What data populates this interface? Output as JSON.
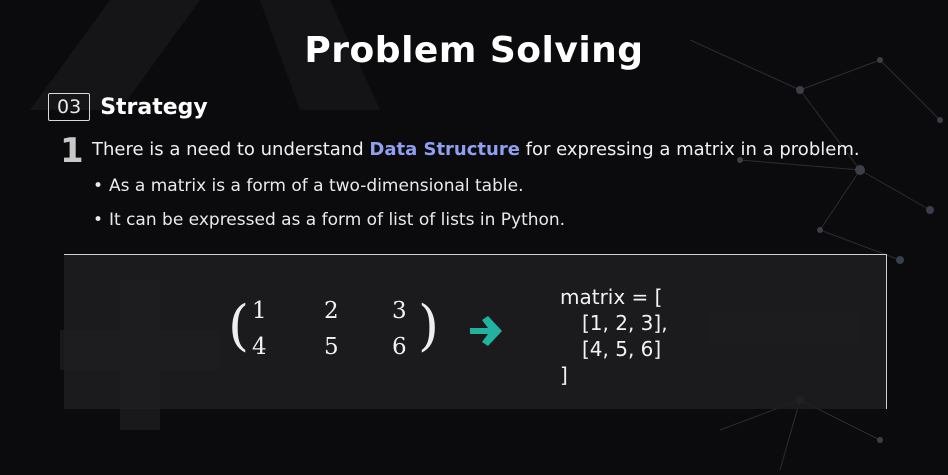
{
  "slide": {
    "title": "Problem Solving",
    "section_number": "03",
    "section_title": "Strategy",
    "point_number": "1",
    "point_text_before": "There is a need to understand ",
    "point_text_highlight": "Data Structure",
    "point_text_after": " for expressing a matrix in a problem.",
    "bullets": [
      "As a matrix is a form of a two-dimensional table.",
      "It can be expressed as a form of list of lists in Python."
    ],
    "bullet_marker": "•",
    "matrix": {
      "rows": [
        [
          "1",
          "2",
          "3"
        ],
        [
          "4",
          "5",
          "6"
        ]
      ],
      "left_paren": "(",
      "right_paren": ")"
    },
    "code_lines": [
      "matrix = [",
      "[1, 2, 3],",
      "[4, 5, 6]",
      "]"
    ],
    "colors": {
      "highlight": "#8fa0f0",
      "arrow": "#22b3a0",
      "background": "#0b0b0d"
    },
    "icons": {
      "arrow": "right-arrow-icon"
    }
  }
}
